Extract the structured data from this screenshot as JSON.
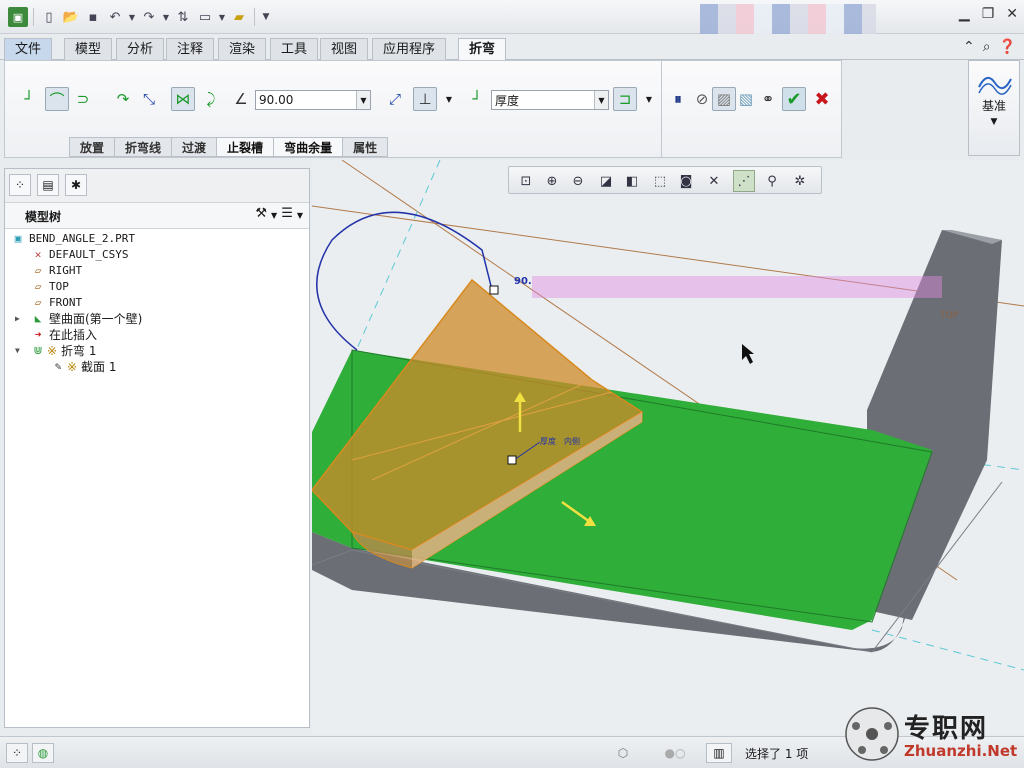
{
  "quick_access": {
    "icons": [
      "app-icon",
      "new-icon",
      "open-icon",
      "save-icon",
      "undo-icon",
      "dropdown-icon",
      "redo-icon",
      "dropdown-icon",
      "regenerate-icon",
      "windows-icon",
      "dropdown-icon",
      "close-window-icon",
      "customize-icon"
    ]
  },
  "ribbon_tabs": [
    {
      "label": "文件",
      "type": "file"
    },
    {
      "label": "模型"
    },
    {
      "label": "分析"
    },
    {
      "label": "注释"
    },
    {
      "label": "渲染"
    },
    {
      "label": "工具"
    },
    {
      "label": "视图"
    },
    {
      "label": "应用程序"
    },
    {
      "label": "折弯",
      "active": true
    }
  ],
  "ribbon": {
    "angle_value": "90.00",
    "thickness_value": "厚度",
    "subtabs": [
      "放置",
      "折弯线",
      "过渡",
      "止裂槽",
      "弯曲余量",
      "属性"
    ],
    "datum_label": "基准"
  },
  "model_tree": {
    "title": "模型树",
    "items": [
      {
        "label": "BEND_ANGLE_2.PRT",
        "level": 0,
        "icon": "part-icon",
        "expander": ""
      },
      {
        "label": "DEFAULT_CSYS",
        "level": 1,
        "icon": "csys-icon",
        "expander": ""
      },
      {
        "label": "RIGHT",
        "level": 1,
        "icon": "datum-plane-icon",
        "expander": ""
      },
      {
        "label": "TOP",
        "level": 1,
        "icon": "datum-plane-icon",
        "expander": ""
      },
      {
        "label": "FRONT",
        "level": 1,
        "icon": "datum-plane-icon",
        "expander": ""
      },
      {
        "label": "壁曲面(第一个壁)",
        "level": 1,
        "icon": "wall-icon",
        "expander": "▶"
      },
      {
        "label": "在此插入",
        "level": 1,
        "icon": "insert-here-icon",
        "expander": ""
      },
      {
        "label": "折弯 1",
        "level": 1,
        "icon": "bend-icon",
        "expander": "▼",
        "marker": "※"
      },
      {
        "label": "截面 1",
        "level": 2,
        "icon": "sketch-icon",
        "expander": "",
        "marker": "※"
      }
    ]
  },
  "viewport": {
    "angle_label": "90.",
    "top_label": "TOP",
    "dim_label_1": "厚度",
    "dim_label_2": "内侧"
  },
  "status": {
    "selection_text": "选择了 1 项"
  },
  "watermark": {
    "main": "专职网",
    "sub": "Zhuanzhi.Net"
  },
  "colors": {
    "sheet_green": "#2fae3a",
    "bend_orange": "#d78a1e",
    "body_gray": "#6b6f75",
    "accept_green": "#1a9a2a",
    "cancel_red": "#c8161d"
  }
}
